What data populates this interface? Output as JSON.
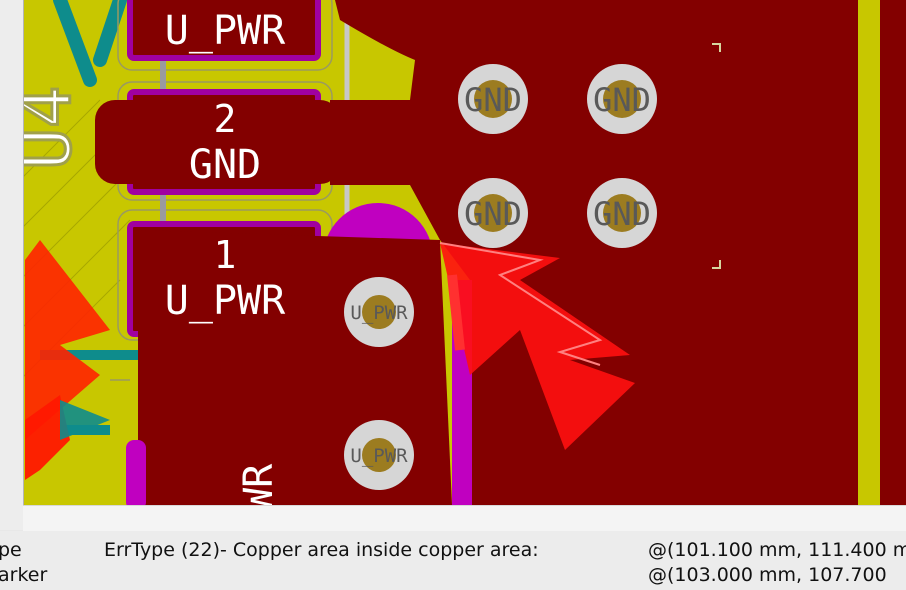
{
  "pcb": {
    "colors": {
      "board_bg": "#c8c700",
      "copper_fill": "#830000",
      "pad_magenta": "#c000c0",
      "via_ring": "#d6d6d6",
      "via_hole": "#9c7c20",
      "marker_red": "#ff1800",
      "track_teal": "#0e8c8c"
    },
    "pads": [
      {
        "number": "",
        "net": "U_PWR"
      },
      {
        "number": "2",
        "net": "GND"
      },
      {
        "number": "1",
        "net": "U_PWR"
      }
    ],
    "bottom_pad_partial": "WR",
    "silk_fragment": "U4",
    "vias": [
      {
        "net": "GND"
      },
      {
        "net": "GND"
      },
      {
        "net": "GND"
      },
      {
        "net": "GND"
      },
      {
        "net": "U_PWR"
      },
      {
        "net": "U_PWR"
      }
    ]
  },
  "status_bar": {
    "col1_line1": "pe",
    "col1_line2": "arker",
    "col2_line1": "ErrType (22)- Copper area inside copper area:",
    "col3_line1": "@(101.100 mm, 111.400 m",
    "col3_line2": "@(103.000 mm, 107.700"
  }
}
